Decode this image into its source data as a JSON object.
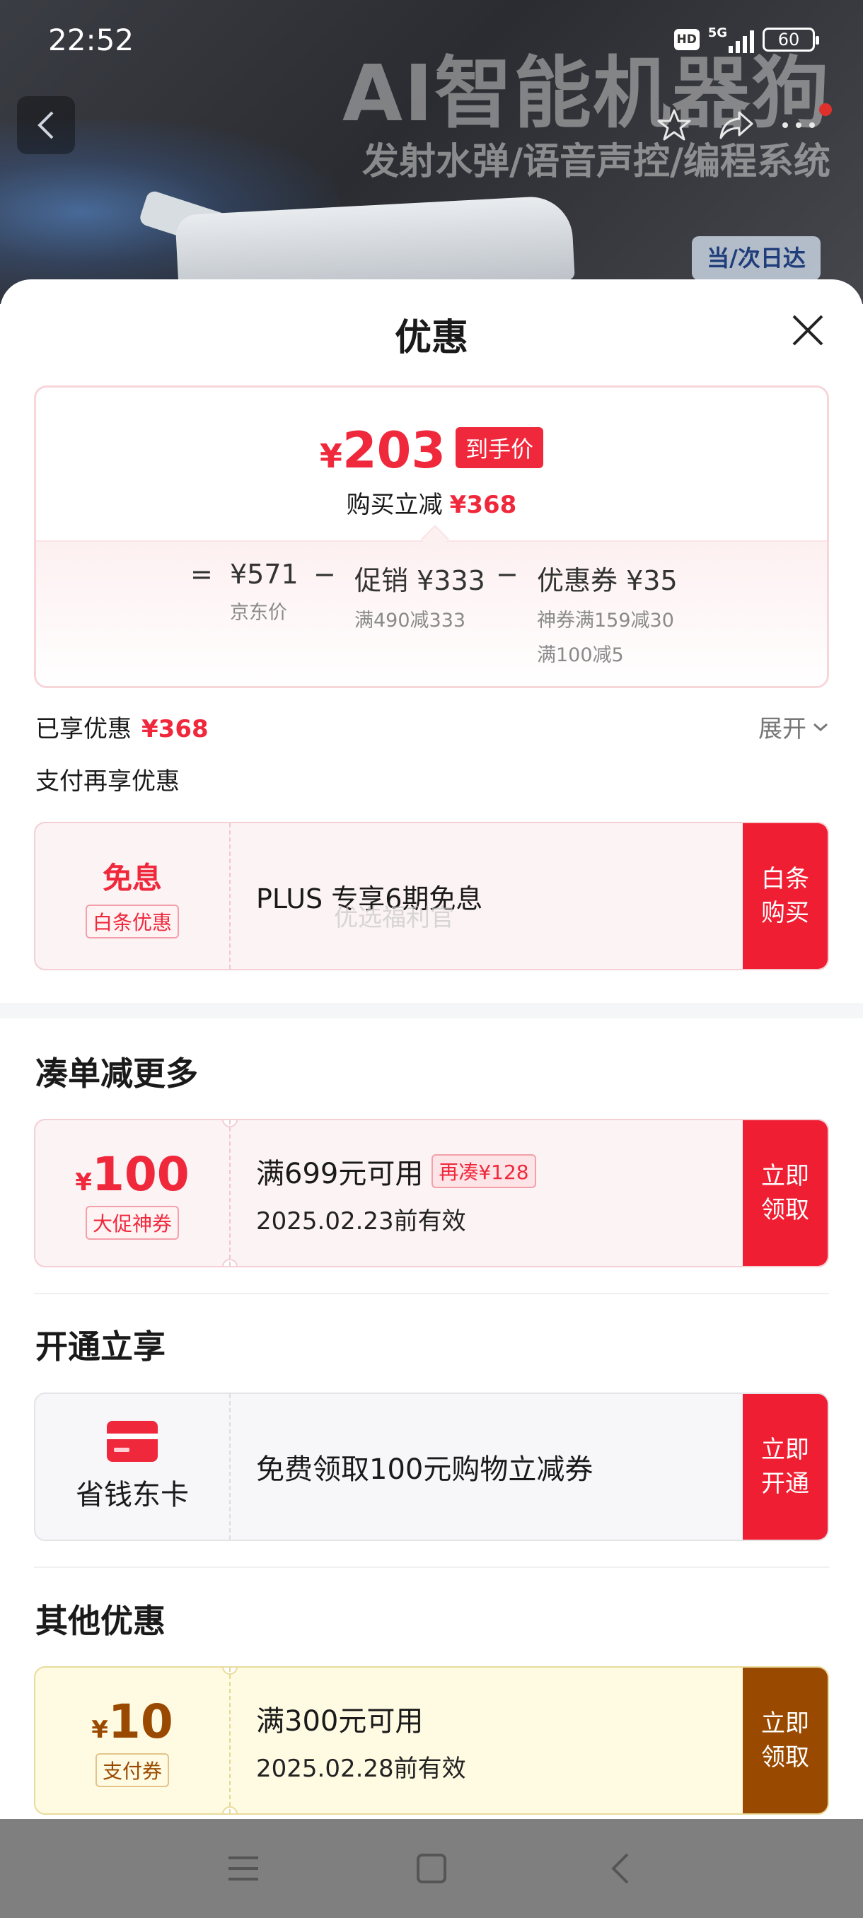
{
  "status_bar": {
    "time": "22:52",
    "hd": "HD",
    "network": "5G",
    "battery": "60"
  },
  "banner": {
    "title": "AI智能机器狗",
    "subtitle": "发射水弹/语音声控/编程系统",
    "badge": "当/次日达"
  },
  "sheet": {
    "title": "优惠",
    "price_card": {
      "currency": "¥",
      "final_price": "203",
      "final_tag": "到手价",
      "reduce_label": "购买立减",
      "reduce_amount": "¥368",
      "equals": "=",
      "minus": "−",
      "jd_price": "¥571",
      "jd_price_label": "京东价",
      "promo_label": "促销",
      "promo_amount": "¥333",
      "promo_detail": "满490减333",
      "coupon_label": "优惠券",
      "coupon_amount": "¥35",
      "coupon_detail_1": "神券满159减30",
      "coupon_detail_2": "满100减5"
    },
    "enjoyed_label": "已享优惠",
    "enjoyed_amount": "¥368",
    "expand_label": "展开",
    "pay_more_label": "支付再享优惠",
    "baitiao_card": {
      "left_title": "免息",
      "left_tag": "白条优惠",
      "text": "PLUS 专享6期免息",
      "action": "白条\n购买"
    },
    "watermark": "优选福利官",
    "section_more": {
      "title": "凑单减更多",
      "coupon": {
        "currency": "¥",
        "amount": "100",
        "tag": "大促神券",
        "condition": "满699元可用",
        "extra_tag": "再凑¥128",
        "validity": "2025.02.23前有效",
        "action": "立即\n领取"
      }
    },
    "section_open": {
      "title": "开通立享",
      "card": {
        "left_title": "省钱东卡",
        "text": "免费领取100元购物立减券",
        "action": "立即\n开通"
      }
    },
    "section_other": {
      "title": "其他优惠",
      "coupon": {
        "currency": "¥",
        "amount": "10",
        "tag": "支付券",
        "condition": "满300元可用",
        "validity": "2025.02.28前有效",
        "action": "立即\n领取"
      }
    }
  },
  "colors": {
    "accent_red": "#f01e32",
    "gold": "#9a4a00",
    "coupon_yellow_bg": "#fffbe3"
  },
  "icons": [
    "back-arrow-icon",
    "star-icon",
    "share-icon",
    "more-icon",
    "close-icon",
    "chevron-down-icon",
    "card-icon",
    "menu-icon",
    "home-square-icon",
    "back-triangle-icon"
  ]
}
